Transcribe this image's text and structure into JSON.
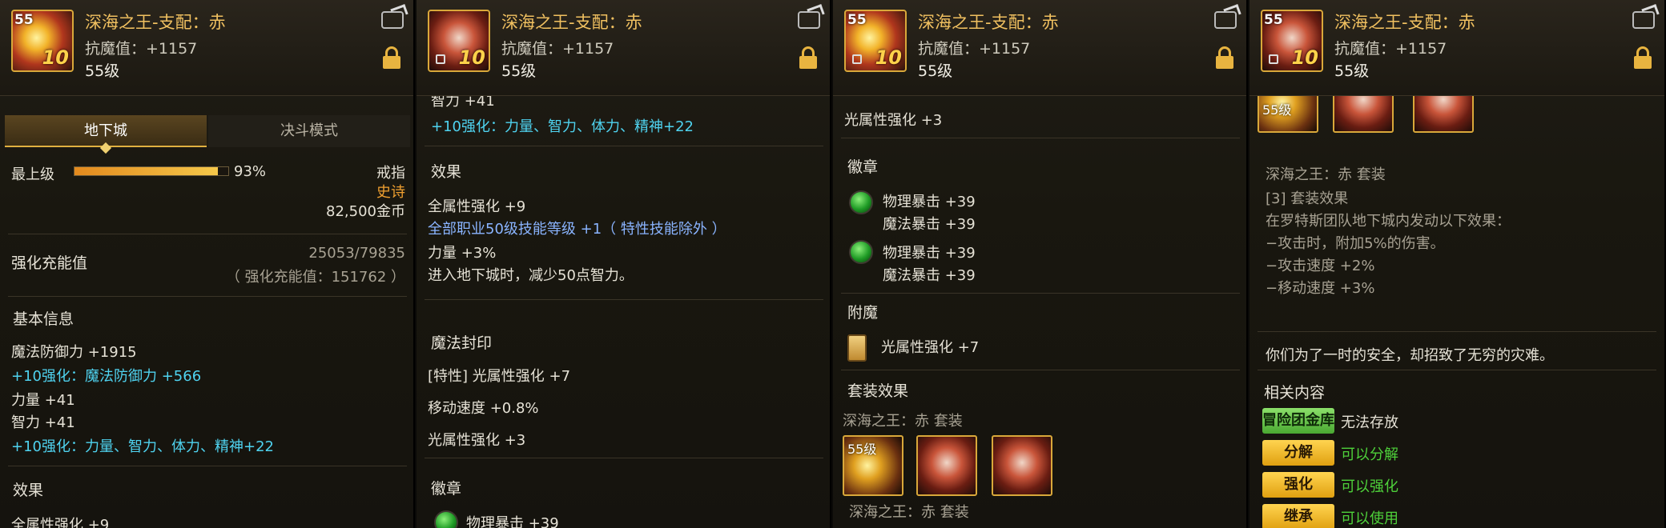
{
  "item": {
    "name": "深海之王-支配：赤",
    "stat_line": "抗魔值：+1157",
    "level": "55级",
    "icon_tag": "55",
    "plus": "10"
  },
  "panel1": {
    "tabs": [
      "地下城",
      "决斗模式"
    ],
    "grade": "最上级",
    "grade_percent_text": "93%",
    "grade_percent": 0.93,
    "type": "戒指",
    "rarity": "史诗",
    "price": "82,500金币",
    "charge_label": "强化充能值",
    "charge_value": "25053/79835",
    "charge_note": "（ 强化充能值：151762 ）",
    "basic_info": "基本信息",
    "stats": [
      "魔法防御力 +1915",
      "+10强化：魔法防御力 +566",
      "力量 +41",
      "智力 +41",
      "+10强化：力量、智力、体力、精神+22"
    ],
    "effects_title": "效果",
    "effect_partial": "全属性强化 +9"
  },
  "panel2": {
    "top_partial": "智力 +41",
    "enhance": "+10强化：力量、智力、体力、精神+22",
    "effects_title": "效果",
    "effects": [
      "全属性强化 +9",
      "全部职业50级技能等级 +1（ 特性技能除外 ）",
      "力量 +3%",
      "进入地下城时，减少50点智力。"
    ],
    "seal_title": "魔法封印",
    "seal": [
      "[特性] 光属性强化 +7",
      "移动速度 +0.8%",
      "光属性强化 +3"
    ],
    "emblem_title": "徽章",
    "emblem_partial": "物理暴击 +39"
  },
  "panel3": {
    "top": "光属性强化 +3",
    "emblem_title": "徽章",
    "emblems": [
      [
        "物理暴击 +39",
        "魔法暴击 +39"
      ],
      [
        "物理暴击 +39",
        "魔法暴击 +39"
      ]
    ],
    "enchant_title": "附魔",
    "enchant": "光属性强化 +7",
    "set_title": "套装效果",
    "set_name": "深海之王：赤 套装",
    "slot_level": "55级",
    "set_name_bottom": "深海之王：赤 套装"
  },
  "panel4": {
    "slot_level": "55级",
    "set_name": "深海之王：赤 套装",
    "set_effects": [
      "[3] 套装效果",
      "在罗特斯团队地下城内发动以下效果：",
      "−攻击时，附加5%的伤害。",
      "−攻击速度 +2%",
      "−移动速度 +3%"
    ],
    "flavor": "你们为了一时的安全，却招致了无穷的灾难。",
    "related_title": "相关内容",
    "actions": [
      {
        "button": "冒险团金库",
        "status": "无法存放"
      },
      {
        "button": "分解",
        "status": "可以分解"
      },
      {
        "button": "强化",
        "status": "可以强化"
      },
      {
        "button": "继承",
        "status": "可以使用"
      }
    ]
  },
  "colors": {
    "gold": "#f0c060",
    "cyan": "#4fd3f0",
    "green": "#4ed13a",
    "orange": "#f0a030"
  }
}
